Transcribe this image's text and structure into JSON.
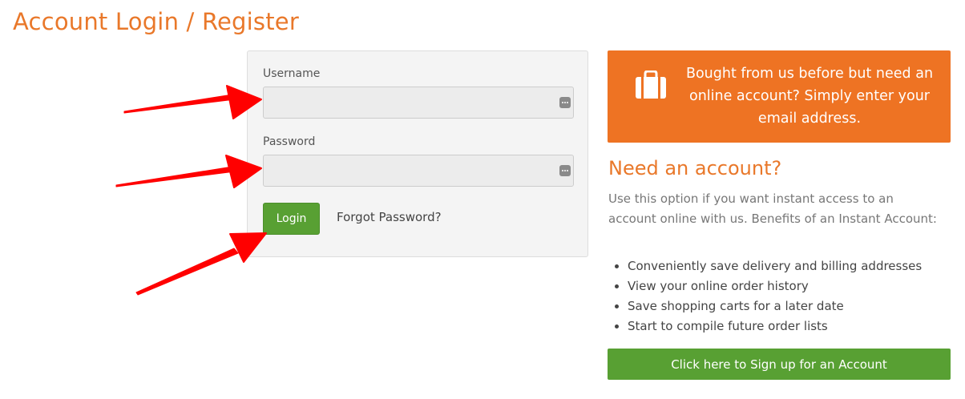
{
  "page": {
    "title": "Account Login / Register"
  },
  "login": {
    "username_label": "Username",
    "username_value": "",
    "password_label": "Password",
    "password_value": "",
    "login_button": "Login",
    "forgot_password": "Forgot Password?",
    "password_manager_icon": "password-manager-icon"
  },
  "promo": {
    "icon": "briefcase-icon",
    "text": "Bought from us before but need an online account? Simply enter your email address."
  },
  "register": {
    "heading": "Need an account?",
    "description": "Use this option if you want instant access to an account online with us. Benefits of an Instant Account:",
    "benefits": [
      "Conveniently save delivery and billing addresses",
      "View your online order history",
      "Save shopping carts for a later date",
      "Start to compile future order lists"
    ],
    "signup_button": "Click here to Sign up for an Account"
  },
  "annotations": {
    "arrow_color": "#ff0000",
    "arrow_targets": [
      "username-input",
      "password-input",
      "login-button"
    ]
  },
  "colors": {
    "accent_orange": "#e9782a",
    "banner_orange": "#ee7323",
    "button_green": "#58a033"
  }
}
